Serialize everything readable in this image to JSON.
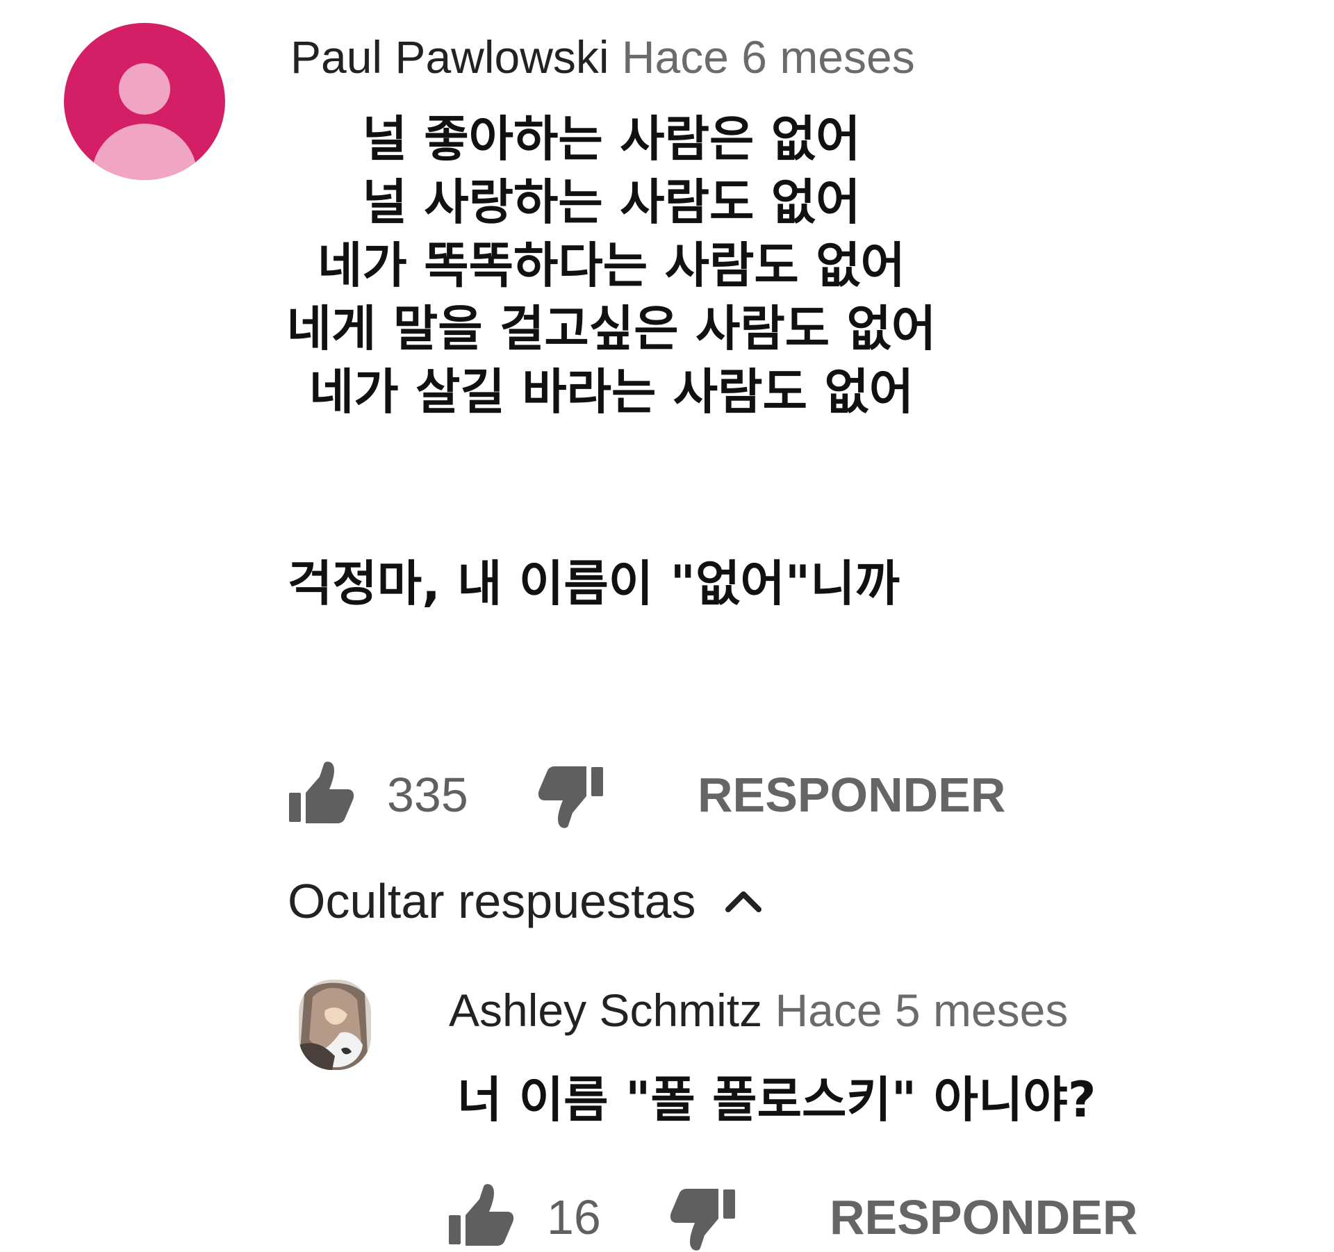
{
  "comment": {
    "avatar_color": "#d41f66",
    "author": "Paul Pawlowski",
    "timestamp": "Hace 6 meses",
    "lines": [
      "널 좋아하는 사람은 없어",
      "널 사랑하는 사람도 없어",
      "네가 똑똑하다는 사람도 없어",
      "네게 말을 걸고싶은 사람도 없어",
      "네가 살길 바라는 사람도 없어"
    ],
    "punchline": "걱정마, 내 이름이 \"없어\"니까",
    "likes": "335",
    "reply_label": "RESPONDER"
  },
  "hide_replies_label": "Ocultar respuestas",
  "reply": {
    "author": "Ashley Schmitz",
    "timestamp": "Hace 5 meses",
    "text": "너 이름 \"폴 폴로스키\" 아니야?",
    "likes": "16",
    "reply_label": "RESPONDER"
  },
  "icons": {
    "like": "thumbs-up-icon",
    "dislike": "thumbs-down-icon",
    "chevron": "chevron-up-icon",
    "avatar_default": "default-user-avatar-icon"
  }
}
